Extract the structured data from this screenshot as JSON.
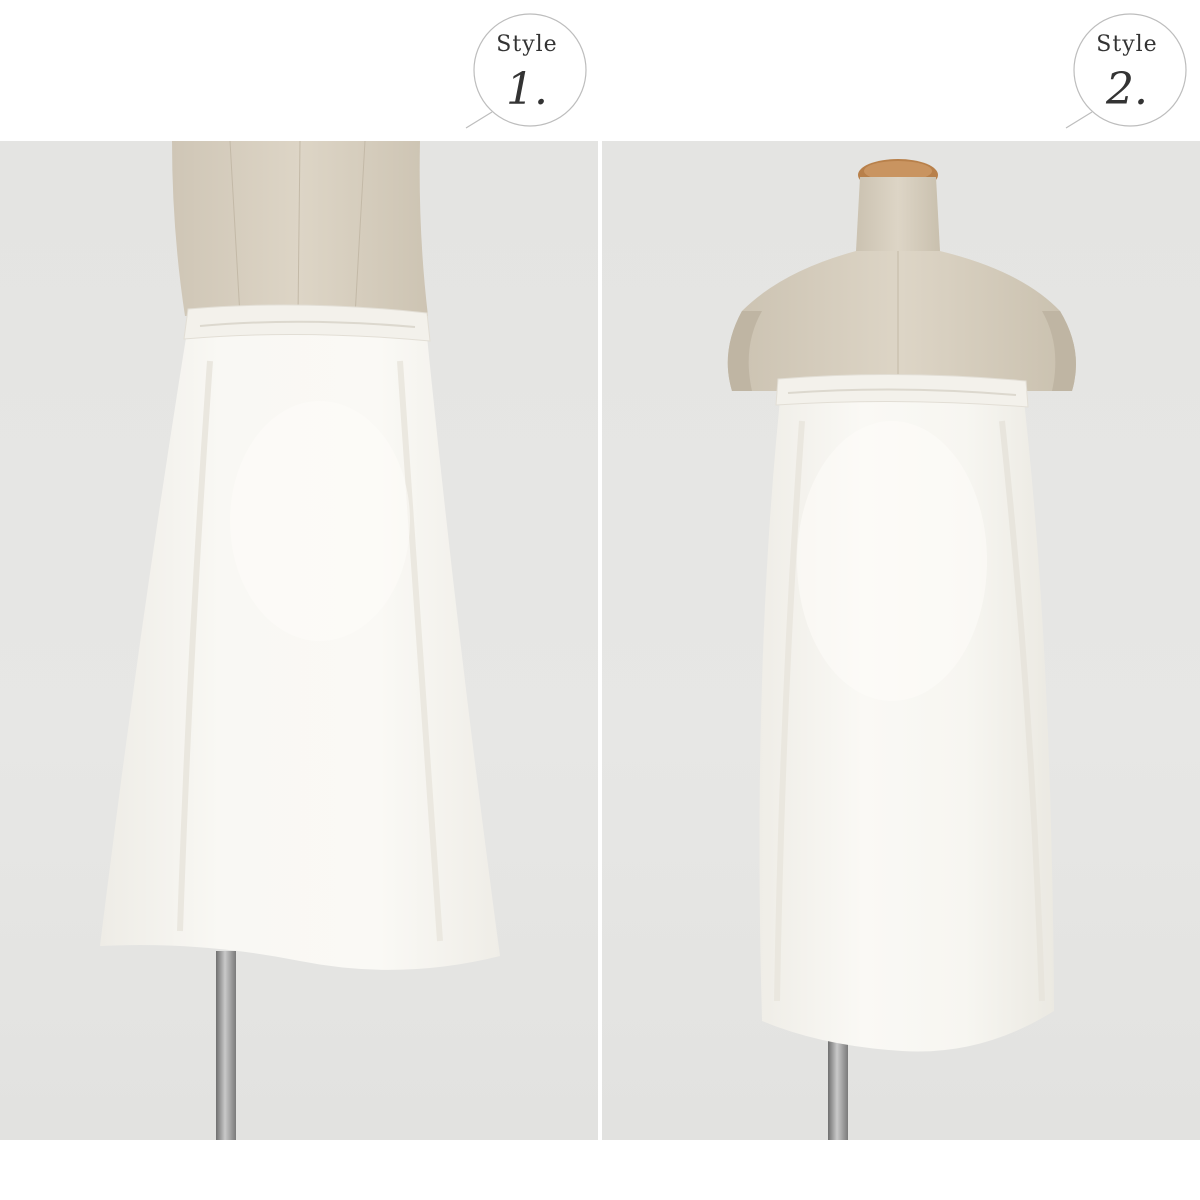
{
  "badges": [
    {
      "word": "Style",
      "number": "1."
    },
    {
      "word": "Style",
      "number": "2."
    }
  ],
  "colors": {
    "backdrop": "#e4e4e2",
    "linen": "#d8cfbf",
    "garment": "#f8f7f3",
    "pole": "#9a9a9a",
    "cap": "#b8804a",
    "badge_ring": "#bdbdbd"
  }
}
